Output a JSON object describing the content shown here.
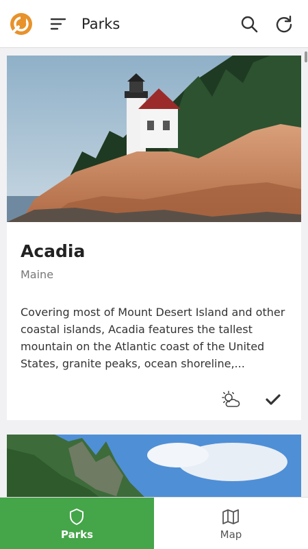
{
  "app": {
    "title": "Parks"
  },
  "icons": {
    "logo": "wrench-logo-icon",
    "menu": "menu-icon",
    "search": "search-icon",
    "refresh": "refresh-icon",
    "weather": "partly-cloudy-icon",
    "visited": "check-icon",
    "parks_tab": "shield-icon",
    "map_tab": "map-icon"
  },
  "colors": {
    "accent": "#45a549",
    "logo": "#e8922b"
  },
  "parks": [
    {
      "name": "Acadia",
      "state": "Maine",
      "description": "Covering most of Mount Desert Island and other coastal islands, Acadia features the tallest mountain on the Atlantic coast of the United States, granite peaks, ocean shoreline,..."
    }
  ],
  "bottom_nav": {
    "items": [
      {
        "label": "Parks",
        "active": true
      },
      {
        "label": "Map",
        "active": false
      }
    ]
  }
}
